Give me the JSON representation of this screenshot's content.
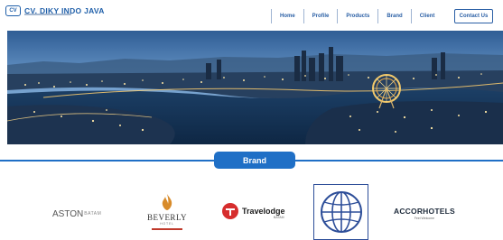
{
  "header": {
    "logo_mark": "CV",
    "logo_text": "CV. DIKY INDO JAVA",
    "nav": [
      {
        "label": "Home"
      },
      {
        "label": "Profile"
      },
      {
        "label": "Products"
      },
      {
        "label": "Brand"
      },
      {
        "label": "Client"
      }
    ],
    "contact_label": "Contact Us"
  },
  "hero": {
    "icon": "city-night-skyline-image"
  },
  "brand_section": {
    "title": "Brand",
    "accent_color": "#1f6fc6",
    "logos": {
      "aston": {
        "main": "ASTON",
        "small": "BATAM"
      },
      "beverly": {
        "name": "BEVERLY",
        "sub": "HOTEL"
      },
      "travelodge": {
        "name": "Travelodge",
        "sub": "BATAM"
      },
      "accor": {
        "name": "ACCORHOTELS",
        "sub": "Feel Welcome"
      }
    }
  },
  "colors": {
    "nav_text": "#2a5fa5",
    "brand_blue": "#1f6fc6"
  }
}
